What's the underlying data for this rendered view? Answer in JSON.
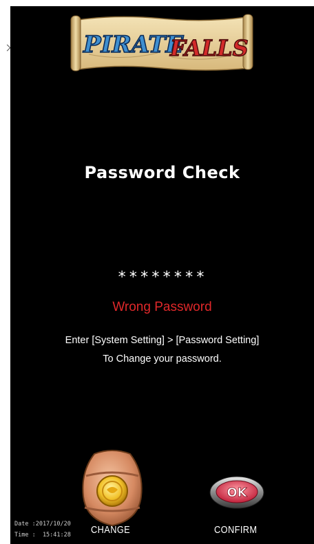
{
  "logo": {
    "word1": "PIRATE",
    "word2": "FALLS"
  },
  "screen": {
    "title": "Password Check",
    "password_mask": "********",
    "error": "Wrong Password",
    "hint_line1": "Enter [System Setting] > [Password Setting]",
    "hint_line2": "To Change your password."
  },
  "buttons": {
    "change_label": "CHANGE",
    "confirm_label": "CONFIRM",
    "confirm_badge": "OK"
  },
  "footer": {
    "date": "Date :2017/10/20",
    "time": "Time :  15:41:28"
  },
  "colors": {
    "background": "#000000",
    "error": "#e0282a",
    "text": "#ffffff"
  }
}
